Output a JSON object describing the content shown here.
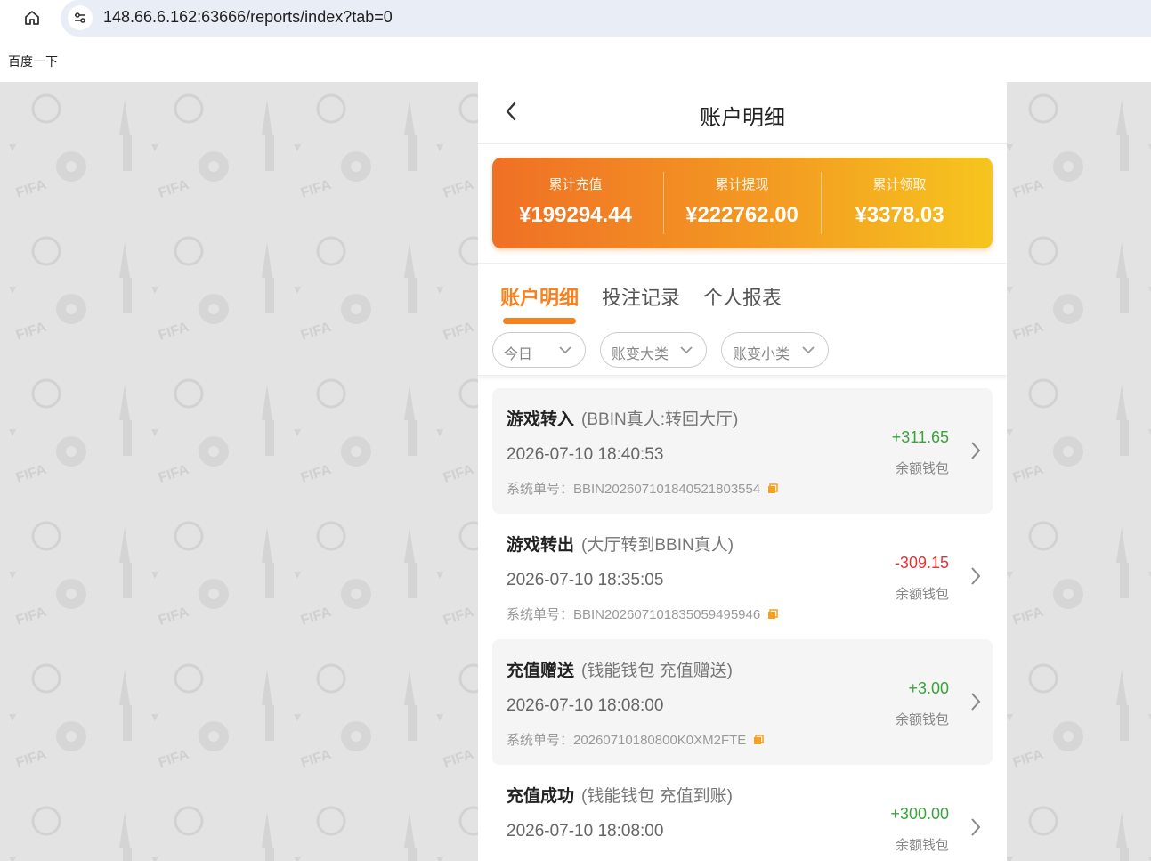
{
  "browser": {
    "url": "148.66.6.162:63666/reports/index?tab=0",
    "bookmark": "百度一下"
  },
  "app": {
    "title": "账户明细",
    "summary": [
      {
        "label": "累计充值",
        "value": "¥199294.44"
      },
      {
        "label": "累计提现",
        "value": "¥222762.00"
      },
      {
        "label": "累计领取",
        "value": "¥3378.03"
      }
    ],
    "tabs": [
      {
        "label": "账户明细",
        "active": true
      },
      {
        "label": "投注记录",
        "active": false
      },
      {
        "label": "个人报表",
        "active": false
      }
    ],
    "filters": [
      {
        "label": "今日"
      },
      {
        "label": "账变大类"
      },
      {
        "label": "账变小类"
      }
    ],
    "transactions": [
      {
        "title": "游戏转入",
        "detail": "(BBIN真人:转回大厅)",
        "time": "2026-07-10 18:40:53",
        "order": "系统单号：BBIN202607101840521803554",
        "amount": "+311.65",
        "wallet": "余额钱包",
        "sign": "pos"
      },
      {
        "title": "游戏转出",
        "detail": "(大厅转到BBIN真人)",
        "time": "2026-07-10 18:35:05",
        "order": "系统单号：BBIN202607101835059495946",
        "amount": "-309.15",
        "wallet": "余额钱包",
        "sign": "neg"
      },
      {
        "title": "充值赠送",
        "detail": "(钱能钱包 充值赠送)",
        "time": "2026-07-10 18:08:00",
        "order": "系统单号：20260710180800K0XM2FTE",
        "amount": "+3.00",
        "wallet": "余额钱包",
        "sign": "pos"
      },
      {
        "title": "充值成功",
        "detail": "(钱能钱包 充值到账)",
        "time": "2026-07-10 18:08:00",
        "order": "",
        "amount": "+300.00",
        "wallet": "余额钱包",
        "sign": "pos"
      }
    ]
  },
  "colors": {
    "accent": "#f5821f",
    "positive": "#3aa33a",
    "negative": "#e03535"
  }
}
